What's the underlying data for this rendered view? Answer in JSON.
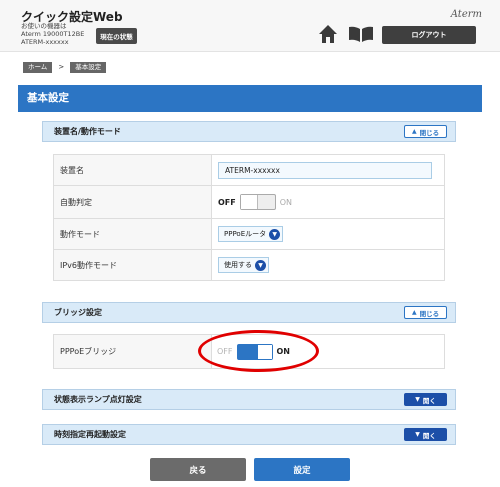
{
  "header": {
    "app_title": "クイック設定Web",
    "device_label": "お使いの機器は",
    "device_model": "Aterm 19000T12BE",
    "device_name": "ATERM-xxxxxx",
    "status_button": "現在の状態",
    "brand": "Aterm",
    "logout_button": "ログアウト"
  },
  "breadcrumb": {
    "home": "ホーム",
    "separator": ">",
    "current": "基本設定"
  },
  "page_title": "基本設定",
  "sections": {
    "device_mode": {
      "title": "装置名/動作モード",
      "toggle_button": "閉じる",
      "rows": {
        "device_name": {
          "label": "装置名",
          "value": "ATERM-xxxxxx"
        },
        "auto_detect": {
          "label": "自動判定",
          "off": "OFF",
          "on": "ON",
          "state": "OFF"
        },
        "operation_mode": {
          "label": "動作モード",
          "value": "PPPoEルータ"
        },
        "ipv6_mode": {
          "label": "IPv6動作モード",
          "value": "使用する"
        }
      }
    },
    "bridge": {
      "title": "ブリッジ設定",
      "toggle_button": "閉じる",
      "rows": {
        "pppoe_bridge": {
          "label": "PPPoEブリッジ",
          "off": "OFF",
          "on": "ON",
          "state": "ON"
        }
      }
    },
    "lamp": {
      "title": "状態表示ランプ点灯設定",
      "toggle_button": "開く"
    },
    "reboot": {
      "title": "時刻指定再起動設定",
      "toggle_button": "開く"
    }
  },
  "buttons": {
    "back": "戻る",
    "apply": "設定"
  },
  "colors": {
    "accent": "#2c75c4",
    "dark_blue": "#1c4fa8",
    "section_bg": "#d9eaf8",
    "highlight": "#e00000"
  },
  "icons": [
    "home-icon",
    "manual-book-icon",
    "chevron-up-icon",
    "chevron-down-icon"
  ]
}
